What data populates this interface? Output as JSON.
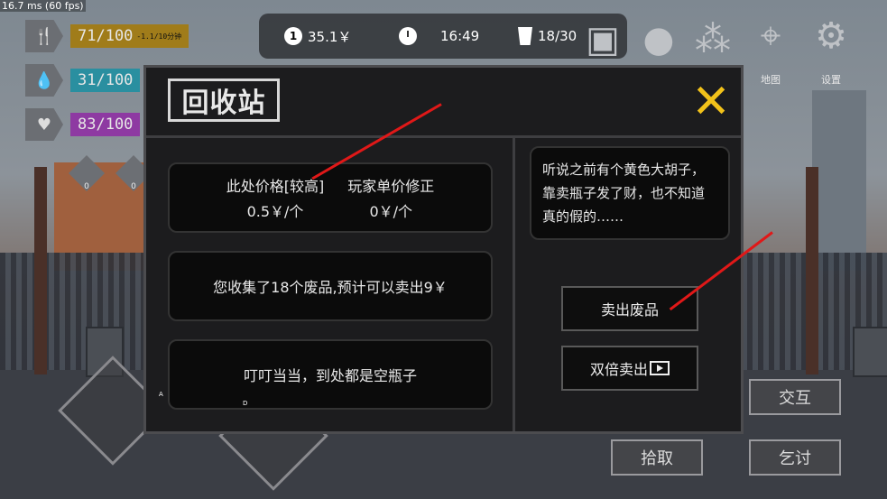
{
  "fps_text": "16.7 ms (60 fps)",
  "stats": [
    {
      "icon": "fork-knife-icon",
      "value": "71/100",
      "note": "-1.1/10分钟",
      "color": "#a07c1a"
    },
    {
      "icon": "water-drop-icon",
      "value": "31/100",
      "note": "",
      "color": "#2a8fa0"
    },
    {
      "icon": "heartbeat-icon",
      "value": "83/100",
      "note": "",
      "color": "#8e3aa2"
    }
  ],
  "status_bubbles": [
    {
      "icon": "muscle-icon",
      "value": "0"
    },
    {
      "icon": "running-icon",
      "value": "0"
    }
  ],
  "topbar": {
    "money": "35.1￥",
    "time": "16:49",
    "bag": "18/30"
  },
  "top_icons": {
    "map_label": "地图",
    "settings_label": "设置"
  },
  "dialog": {
    "title": "回收站",
    "price_panel": {
      "price_label": "此处价格[较高]",
      "price_value": "0.5￥/个",
      "fix_label": "玩家单价修正",
      "fix_value": "0￥/个"
    },
    "collected_text": "您收集了18个废品,预计可以卖出9￥",
    "flavor_text": "叮叮当当，到处都是空瓶子",
    "rumor_text": "听说之前有个黄色大胡子，靠卖瓶子发了财，也不知道真的假的……",
    "sell_button": "卖出废品",
    "double_sell_button": "双倍卖出"
  },
  "controls": {
    "interact": "交互",
    "pickup": "拾取",
    "beg": "乞讨"
  },
  "markers": {
    "a": "A",
    "d": "D"
  },
  "colors": {
    "accent_close": "#f2c21a",
    "annotation_arrow": "#e01818"
  }
}
